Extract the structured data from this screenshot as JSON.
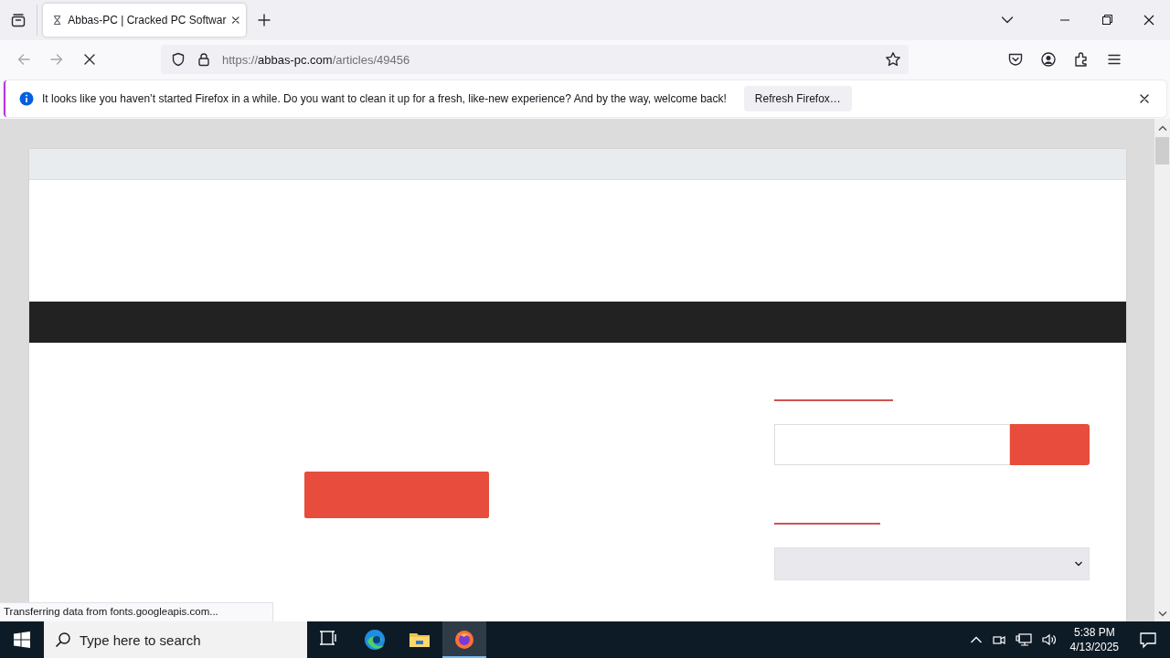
{
  "window": {
    "tabs": [
      {
        "title": "Abbas-PC | Cracked PC Softwar",
        "selected": true,
        "loading": true
      }
    ]
  },
  "address_bar": {
    "scheme": "https://",
    "host": "abbas-pc.com",
    "path": "/articles/49456"
  },
  "notification": {
    "message": "It looks like you haven’t started Firefox in a while. Do you want to clean it up for a fresh, like-new experience? And by the way, welcome back!",
    "button": "Refresh Firefox…"
  },
  "status_bar": {
    "text": "Transferring data from fonts.googleapis.com..."
  },
  "taskbar": {
    "search_placeholder": "Type here to search",
    "apps": [
      {
        "kind": "taskview",
        "selected": false
      },
      {
        "kind": "edge",
        "selected": false
      },
      {
        "kind": "explorer",
        "selected": false
      },
      {
        "kind": "firefox",
        "selected": true
      }
    ],
    "time": "5:38 PM",
    "date": "4/13/2025"
  }
}
